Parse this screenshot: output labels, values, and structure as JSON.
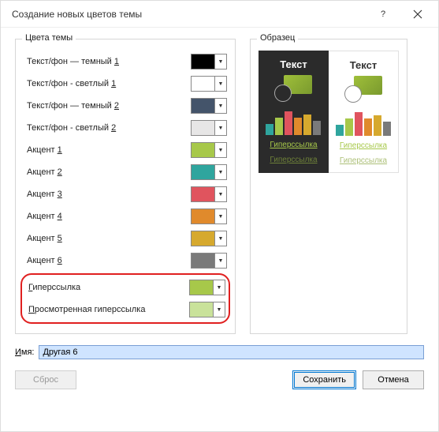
{
  "title": "Создание новых цветов темы",
  "groups": {
    "colors": "Цвета темы",
    "sample": "Образец"
  },
  "rows": [
    {
      "label_pre": "Текст/фон — темный ",
      "accel": "1",
      "color": "#000000"
    },
    {
      "label_pre": "Текст/фон - светлый ",
      "accel": "1",
      "color": "#ffffff"
    },
    {
      "label_pre": "Текст/фон — темный ",
      "accel": "2",
      "color": "#44546a"
    },
    {
      "label_pre": "Текст/фон - светлый ",
      "accel": "2",
      "color": "#e7e6e6"
    },
    {
      "label_pre": "Акцент ",
      "accel": "1",
      "color": "#a7c84a"
    },
    {
      "label_pre": "Акцент ",
      "accel": "2",
      "color": "#2fa59e"
    },
    {
      "label_pre": "Акцент ",
      "accel": "3",
      "color": "#e0545e"
    },
    {
      "label_pre": "Акцент ",
      "accel": "4",
      "color": "#e08a2c"
    },
    {
      "label_pre": "Акцент ",
      "accel": "5",
      "color": "#d6a92e"
    },
    {
      "label_pre": "Акцент ",
      "accel": "6",
      "color": "#7a7a7a"
    }
  ],
  "hyperlinks": [
    {
      "accel": "Г",
      "label_post": "иперссылка",
      "color": "#a7c84a"
    },
    {
      "accel": "П",
      "label_post": "росмотренная гиперссылка",
      "color": "#c9e29a"
    }
  ],
  "sample": {
    "text": "Текст",
    "link": "Гиперссылка",
    "visited": "Гиперссылка",
    "bars": [
      "#2fa59e",
      "#a7c84a",
      "#e0545e",
      "#e08a2c",
      "#d6a92e",
      "#7a7a7a"
    ]
  },
  "name": {
    "label_accel": "И",
    "label_post": "мя:",
    "value": "Другая 6"
  },
  "buttons": {
    "reset_pre": "С",
    "reset_accel": "б",
    "reset_post": "рос",
    "save": "Сохранить",
    "cancel": "Отмена"
  },
  "icons": {
    "help": "?"
  }
}
